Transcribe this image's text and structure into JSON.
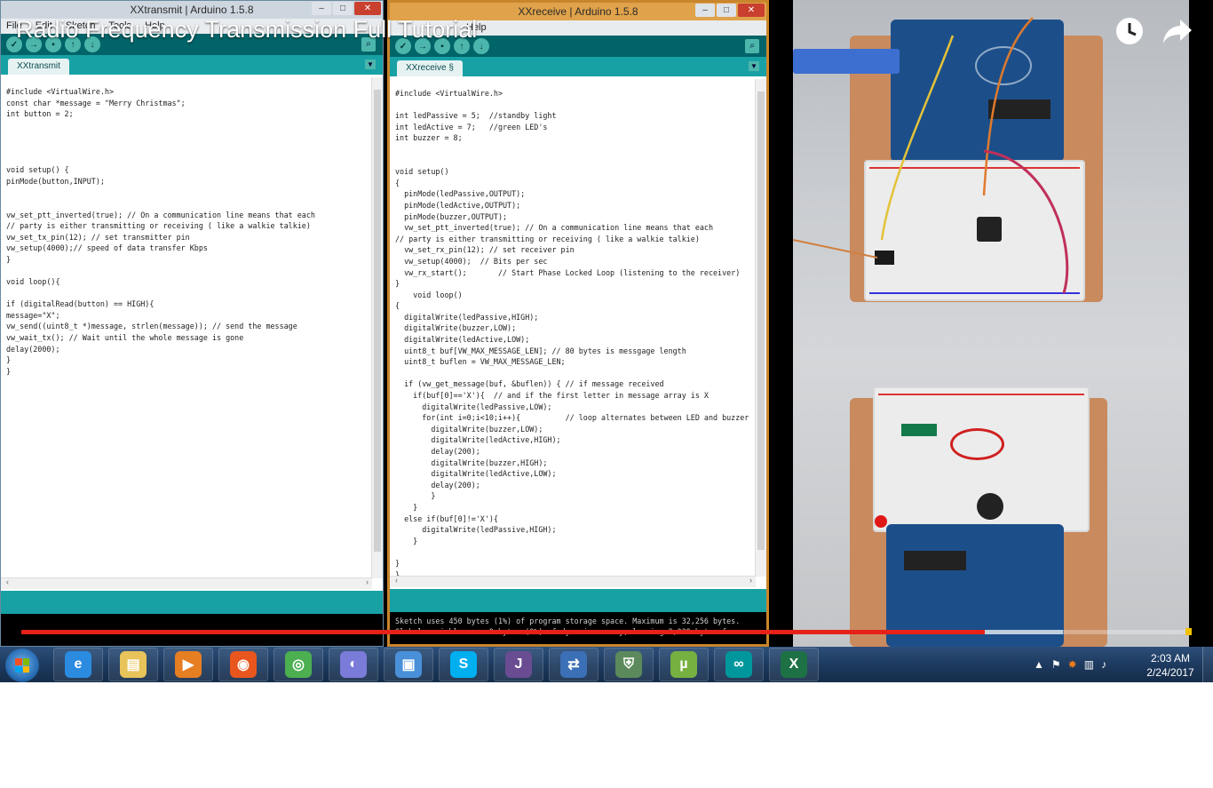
{
  "video": {
    "title": "Radio Frequency Transmission Full Tutorial",
    "watch_later_icon": "clock-icon",
    "share_icon": "share-arrow-icon",
    "progress_played": 0.823,
    "progress_loaded": 0.89,
    "progress_color": "#e62117"
  },
  "left_ide": {
    "window_title": "XXtransmit | Arduino 1.5.8",
    "menu": [
      "File",
      "Edit",
      "Sketch",
      "Tools",
      "Help"
    ],
    "tab_label": "XXtransmit",
    "code": [
      "#include <VirtualWire.h>",
      "const char *message = \"Merry Christmas\";",
      "int button = 2;",
      "",
      "",
      "",
      "",
      "void setup() {",
      "pinMode(button,INPUT);",
      "",
      "",
      "vw_set_ptt_inverted(true); // On a communication line means that each",
      "// party is either transmitting or receiving ( like a walkie talkie)",
      "vw_set_tx_pin(12); // set transmitter pin",
      "vw_setup(4000);// speed of data transfer Kbps",
      "}",
      "",
      "void loop(){",
      "",
      "if (digitalRead(button) == HIGH){",
      "message=\"X\";",
      "vw_send((uint8_t *)message, strlen(message)); // send the message",
      "vw_wait_tx(); // Wait until the whole message is gone",
      "delay(2000);",
      "}",
      "}"
    ]
  },
  "right_ide": {
    "window_title": "XXreceive | Arduino 1.5.8",
    "menu_help": "Help",
    "tab_label": "XXreceive §",
    "code": [
      "#include <VirtualWire.h>",
      "",
      "int ledPassive = 5;  //standby light",
      "int ledActive = 7;   //green LED's",
      "int buzzer = 8;",
      "",
      "",
      "void setup()",
      "{",
      "  pinMode(ledPassive,OUTPUT);",
      "  pinMode(ledActive,OUTPUT);",
      "  pinMode(buzzer,OUTPUT);",
      "  vw_set_ptt_inverted(true); // On a communication line means that each",
      "// party is either transmitting or receiving ( like a walkie talkie)",
      "  vw_set_rx_pin(12); // set receiver pin",
      "  vw_setup(4000);  // Bits per sec",
      "  vw_rx_start();       // Start Phase Locked Loop (listening to the receiver)",
      "}",
      "    void loop()",
      "{",
      "  digitalWrite(ledPassive,HIGH);",
      "  digitalWrite(buzzer,LOW);",
      "  digitalWrite(ledActive,LOW);",
      "  uint8_t buf[VW_MAX_MESSAGE_LEN]; // 80 bytes is messgage length",
      "  uint8_t buflen = VW_MAX_MESSAGE_LEN;",
      "",
      "  if (vw_get_message(buf, &buflen)) { // if message received",
      "    if(buf[0]=='X'){  // and if the first letter in message array is X",
      "      digitalWrite(ledPassive,LOW);",
      "      for(int i=0;i<10;i++){          // loop alternates between LED and buzzer",
      "        digitalWrite(buzzer,LOW);",
      "        digitalWrite(ledActive,HIGH);",
      "        delay(200);",
      "        digitalWrite(buzzer,HIGH);",
      "        digitalWrite(ledActive,LOW);",
      "        delay(200);",
      "        }",
      "    }",
      "  else if(buf[0]!='X'){",
      "      digitalWrite(ledPassive,HIGH);",
      "    }",
      "",
      "}",
      "}"
    ],
    "console": [
      "Sketch uses 450 bytes (1%) of program storage space. Maximum is 32,256 bytes.",
      "Global variables use 9 bytes (0%) of dynamic memory, leaving 2,039 bytes for"
    ]
  },
  "taskbar": {
    "start_icon": "windows-start-icon",
    "apps": [
      {
        "name": "internet-explorer-icon",
        "color": "#2b8be0"
      },
      {
        "name": "file-explorer-icon",
        "color": "#e7c35a"
      },
      {
        "name": "media-player-icon",
        "color": "#e67e22"
      },
      {
        "name": "firefox-icon",
        "color": "#e8561e"
      },
      {
        "name": "chrome-icon",
        "color": "#4caf50"
      },
      {
        "name": "crescent-app-icon",
        "color": "#7b7bd9"
      },
      {
        "name": "remote-desktop-icon",
        "color": "#4a90d9"
      },
      {
        "name": "skype-icon",
        "color": "#00aff0"
      },
      {
        "name": "java-ee-ide-icon",
        "color": "#6a4c93"
      },
      {
        "name": "network-tool-icon",
        "color": "#3b6fb6"
      },
      {
        "name": "vpn-tool-icon",
        "color": "#5c8a5c"
      },
      {
        "name": "utorrent-icon",
        "color": "#76b041"
      },
      {
        "name": "arduino-icon",
        "color": "#00979c"
      },
      {
        "name": "excel-icon",
        "color": "#1e7145"
      }
    ],
    "tray_icons": [
      "show-hidden-icons-icon",
      "action-center-flag-icon",
      "avast-icon",
      "network-icon",
      "volume-icon"
    ],
    "time": "2:03 AM",
    "date": "2/24/2017"
  }
}
